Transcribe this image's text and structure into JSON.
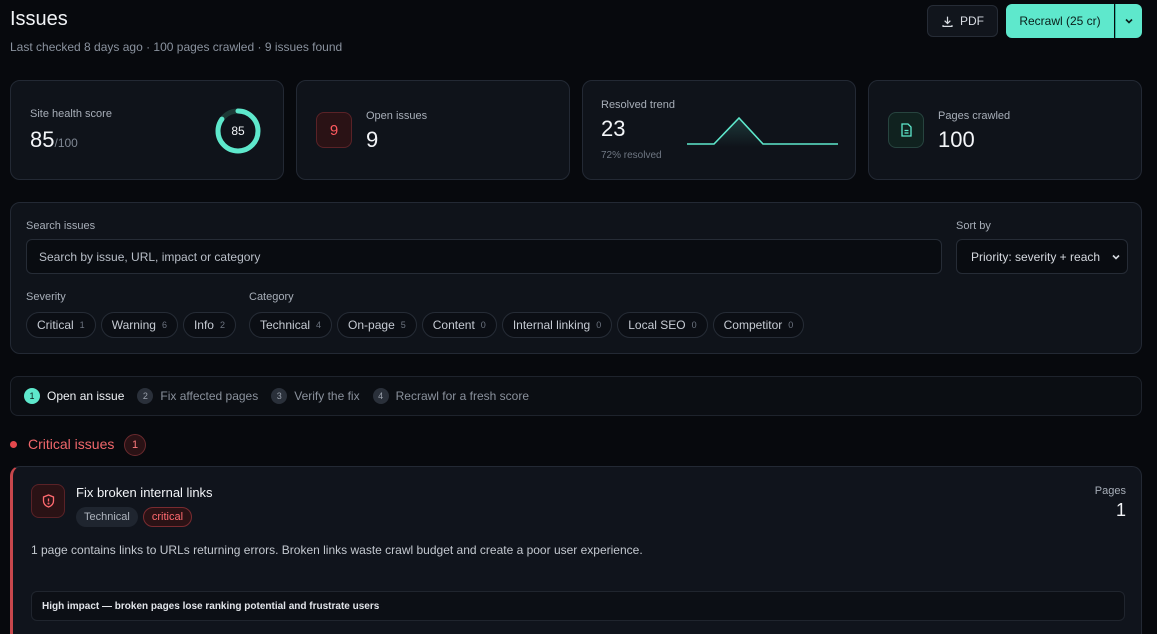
{
  "header": {
    "title": "Issues",
    "subtitle": "Last checked 8 days ago · 100 pages crawled · 9 issues found",
    "pdf_label": "PDF",
    "recrawl_label": "Recrawl (25 cr)"
  },
  "stats": {
    "health": {
      "label": "Site health score",
      "value": "85",
      "suffix": "/100",
      "ring_value": "85",
      "ring_fraction": 0.85
    },
    "open": {
      "label": "Open issues",
      "value": "9",
      "badge": "9"
    },
    "resolved": {
      "label": "Resolved trend",
      "value": "23",
      "note": "72% resolved"
    },
    "pages": {
      "label": "Pages crawled",
      "value": "100"
    }
  },
  "filters": {
    "search_label": "Search issues",
    "search_placeholder": "Search by issue, URL, impact or category",
    "sort_label": "Sort by",
    "sort_value": "Priority: severity + reach",
    "severity_label": "Severity",
    "severity_chips": [
      {
        "label": "Critical",
        "count": "1"
      },
      {
        "label": "Warning",
        "count": "6"
      },
      {
        "label": "Info",
        "count": "2"
      }
    ],
    "category_label": "Category",
    "category_chips": [
      {
        "label": "Technical",
        "count": "4"
      },
      {
        "label": "On-page",
        "count": "5"
      },
      {
        "label": "Content",
        "count": "0"
      },
      {
        "label": "Internal linking",
        "count": "0"
      },
      {
        "label": "Local SEO",
        "count": "0"
      },
      {
        "label": "Competitor",
        "count": "0"
      }
    ]
  },
  "steps": [
    {
      "num": "1",
      "label": "Open an issue"
    },
    {
      "num": "2",
      "label": "Fix affected pages"
    },
    {
      "num": "3",
      "label": "Verify the fix"
    },
    {
      "num": "4",
      "label": "Recrawl for a fresh score"
    }
  ],
  "section": {
    "title": "Critical issues",
    "count": "1"
  },
  "issue": {
    "title": "Fix broken internal links",
    "tag_category": "Technical",
    "tag_severity": "critical",
    "pages_label": "Pages",
    "pages_value": "1",
    "description": "1 page contains links to URLs returning errors. Broken links waste crawl budget and create a poor user experience.",
    "impact": "High impact — broken pages lose ranking potential and frustrate users"
  },
  "colors": {
    "accent": "#5ee8cc",
    "critical": "#e5484d",
    "background": "#07090d"
  }
}
